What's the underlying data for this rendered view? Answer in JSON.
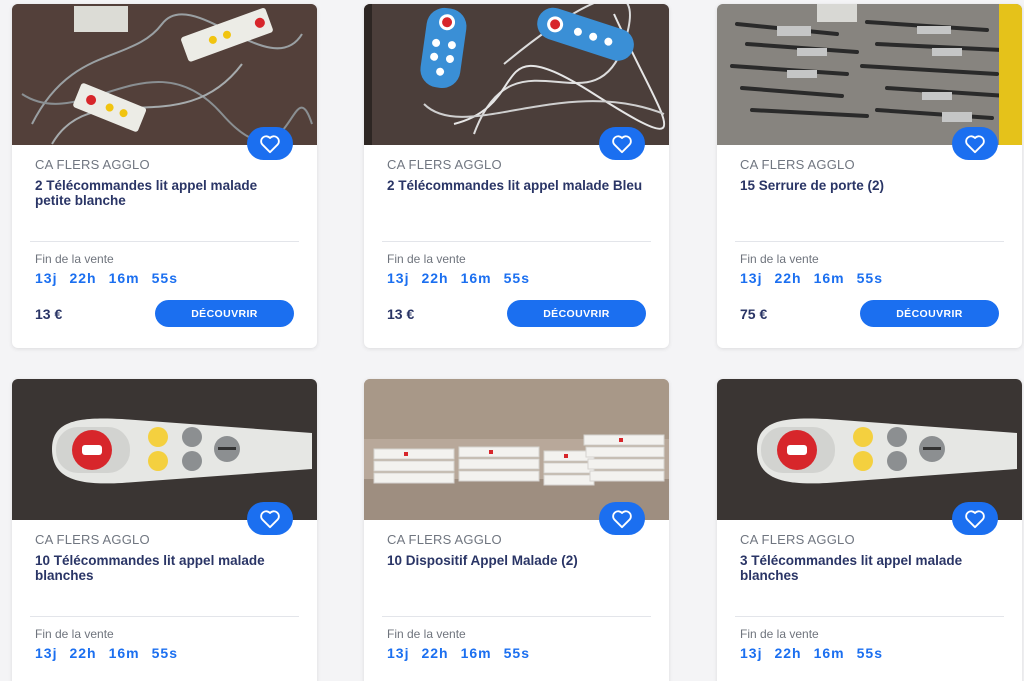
{
  "listings": [
    {
      "seller": "CA FLERS AGGLO",
      "title": "2 Télécommandes lit appel malade petite blanche",
      "end_label": "Fin de la vente",
      "countdown": {
        "days": "13j",
        "hours": "22h",
        "minutes": "16m",
        "seconds": "55s"
      },
      "price": "13 €",
      "cta": "DÉCOUVRIR",
      "image": "white-bed-remotes-with-cables"
    },
    {
      "seller": "CA FLERS AGGLO",
      "title": "2 Télécommandes lit appel malade Bleu",
      "end_label": "Fin de la vente",
      "countdown": {
        "days": "13j",
        "hours": "22h",
        "minutes": "16m",
        "seconds": "55s"
      },
      "price": "13 €",
      "cta": "DÉCOUVRIR",
      "image": "blue-bed-remotes-with-cables"
    },
    {
      "seller": "CA FLERS AGGLO",
      "title": "15 Serrure de porte (2)",
      "end_label": "Fin de la vente",
      "countdown": {
        "days": "13j",
        "hours": "22h",
        "minutes": "16m",
        "seconds": "55s"
      },
      "price": "75 €",
      "cta": "DÉCOUVRIR",
      "image": "door-locks-pile"
    },
    {
      "seller": "CA FLERS AGGLO",
      "title": "10 Télécommandes lit appel malade blanches",
      "end_label": "Fin de la vente",
      "countdown": {
        "days": "13j",
        "hours": "22h",
        "minutes": "16m",
        "seconds": "55s"
      },
      "price": "",
      "cta": "",
      "image": "white-call-remote-closeup"
    },
    {
      "seller": "CA FLERS AGGLO",
      "title": "10 Dispositif Appel Malade (2)",
      "end_label": "Fin de la vente",
      "countdown": {
        "days": "13j",
        "hours": "22h",
        "minutes": "16m",
        "seconds": "55s"
      },
      "price": "",
      "cta": "",
      "image": "stacked-device-boxes"
    },
    {
      "seller": "CA FLERS AGGLO",
      "title": "3 Télécommandes lit appel malade blanches",
      "end_label": "Fin de la vente",
      "countdown": {
        "days": "13j",
        "hours": "22h",
        "minutes": "16m",
        "seconds": "55s"
      },
      "price": "",
      "cta": "",
      "image": "white-call-remote-closeup"
    }
  ],
  "icons": {
    "favorite": "heart-outline-icon"
  },
  "colors": {
    "accent": "#1b6ff0",
    "title": "#2a3566",
    "muted": "#707680"
  }
}
